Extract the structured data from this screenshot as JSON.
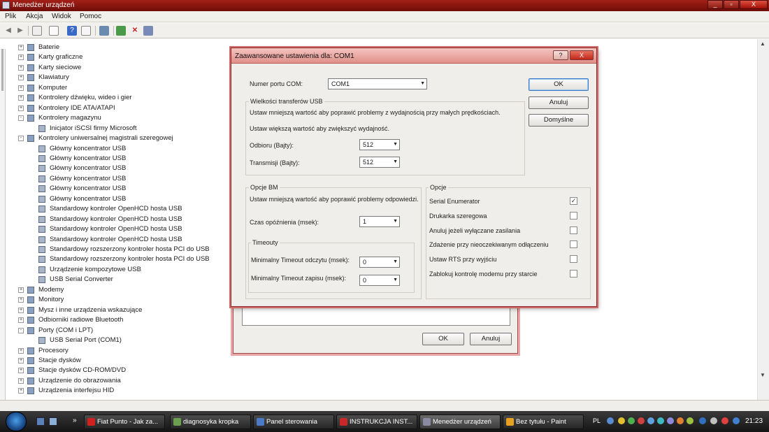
{
  "window": {
    "title": "Menedżer urządzeń",
    "controls": [
      "_",
      "▫",
      "X"
    ]
  },
  "menu": [
    "Plik",
    "Akcja",
    "Widok",
    "Pomoc"
  ],
  "tree": [
    {
      "label": "Baterie",
      "level": 1,
      "exp": "+",
      "icon": "battery-icon"
    },
    {
      "label": "Karty graficzne",
      "level": 1,
      "exp": "+",
      "icon": "display-adapter-icon"
    },
    {
      "label": "Karty sieciowe",
      "level": 1,
      "exp": "+",
      "icon": "network-adapter-icon"
    },
    {
      "label": "Klawiatury",
      "level": 1,
      "exp": "+",
      "icon": "keyboard-icon"
    },
    {
      "label": "Komputer",
      "level": 1,
      "exp": "+",
      "icon": "computer-icon"
    },
    {
      "label": "Kontrolery dźwięku, wideo i gier",
      "level": 1,
      "exp": "+",
      "icon": "sound-icon"
    },
    {
      "label": "Kontrolery IDE ATA/ATAPI",
      "level": 1,
      "exp": "+",
      "icon": "ide-icon"
    },
    {
      "label": "Kontrolery magazynu",
      "level": 1,
      "exp": "-",
      "icon": "storage-icon"
    },
    {
      "label": "Inicjator iSCSI firmy Microsoft",
      "level": 2,
      "exp": "",
      "icon": "iscsi-icon"
    },
    {
      "label": "Kontrolery uniwersalnej magistrali szeregowej",
      "level": 1,
      "exp": "-",
      "icon": "usb-icon"
    },
    {
      "label": "Główny koncentrator USB",
      "level": 2,
      "exp": "",
      "icon": "usb-device-icon"
    },
    {
      "label": "Główny koncentrator USB",
      "level": 2,
      "exp": "",
      "icon": "usb-device-icon"
    },
    {
      "label": "Główny koncentrator USB",
      "level": 2,
      "exp": "",
      "icon": "usb-device-icon"
    },
    {
      "label": "Główny koncentrator USB",
      "level": 2,
      "exp": "",
      "icon": "usb-device-icon"
    },
    {
      "label": "Główny koncentrator USB",
      "level": 2,
      "exp": "",
      "icon": "usb-device-icon"
    },
    {
      "label": "Główny koncentrator USB",
      "level": 2,
      "exp": "",
      "icon": "usb-device-icon"
    },
    {
      "label": "Standardowy kontroler OpenHCD hosta USB",
      "level": 2,
      "exp": "",
      "icon": "usb-device-icon"
    },
    {
      "label": "Standardowy kontroler OpenHCD hosta USB",
      "level": 2,
      "exp": "",
      "icon": "usb-device-icon"
    },
    {
      "label": "Standardowy kontroler OpenHCD hosta USB",
      "level": 2,
      "exp": "",
      "icon": "usb-device-icon"
    },
    {
      "label": "Standardowy kontroler OpenHCD hosta USB",
      "level": 2,
      "exp": "",
      "icon": "usb-device-icon"
    },
    {
      "label": "Standardowy rozszerzony kontroler hosta PCI do USB",
      "level": 2,
      "exp": "",
      "icon": "usb-device-icon"
    },
    {
      "label": "Standardowy rozszerzony kontroler hosta PCI do USB",
      "level": 2,
      "exp": "",
      "icon": "usb-device-icon"
    },
    {
      "label": "Urządzenie kompozytowe USB",
      "level": 2,
      "exp": "",
      "icon": "usb-device-icon"
    },
    {
      "label": "USB Serial Converter",
      "level": 2,
      "exp": "",
      "icon": "usb-device-icon"
    },
    {
      "label": "Modemy",
      "level": 1,
      "exp": "+",
      "icon": "modem-icon"
    },
    {
      "label": "Monitory",
      "level": 1,
      "exp": "+",
      "icon": "monitor-icon"
    },
    {
      "label": "Mysz i inne urządzenia wskazujące",
      "level": 1,
      "exp": "+",
      "icon": "mouse-icon"
    },
    {
      "label": "Odbiorniki radiowe Bluetooth",
      "level": 1,
      "exp": "+",
      "icon": "bluetooth-icon"
    },
    {
      "label": "Porty (COM i LPT)",
      "level": 1,
      "exp": "-",
      "icon": "port-icon"
    },
    {
      "label": "USB Serial Port (COM1)",
      "level": 2,
      "exp": "",
      "icon": "port-device-icon"
    },
    {
      "label": "Procesory",
      "level": 1,
      "exp": "+",
      "icon": "cpu-icon"
    },
    {
      "label": "Stacje dysków",
      "level": 1,
      "exp": "+",
      "icon": "disk-icon"
    },
    {
      "label": "Stacje dysków CD-ROM/DVD",
      "level": 1,
      "exp": "+",
      "icon": "cdrom-icon"
    },
    {
      "label": "Urządzenie do obrazowania",
      "level": 1,
      "exp": "+",
      "icon": "imaging-icon"
    },
    {
      "label": "Urządzenia interfejsu HID",
      "level": 1,
      "exp": "+",
      "icon": "hid-icon"
    }
  ],
  "bg_dialog": {
    "ok": "OK",
    "cancel": "Anuluj"
  },
  "adv": {
    "title": "Zaawansowane ustawienia dla: COM1",
    "help_btn": "?",
    "close_btn": "X",
    "com_port_label": "Numer portu COM:",
    "com_port_value": "COM1",
    "usb_group": "Wielkości transferów USB",
    "usb_hint1": "Ustaw mniejszą wartość aby poprawić problemy z wydajnością przy małych prędkościach.",
    "usb_hint2": "Ustaw większą wartość aby zwiększyć wydajność.",
    "receive_label": "Odbioru (Bajty):",
    "receive_value": "512",
    "transmit_label": "Transmisji (Bajty):",
    "transmit_value": "512",
    "bm_group": "Opcje BM",
    "bm_hint": "Ustaw mniejszą wartość aby poprawić problemy odpowiedzi.",
    "latency_label": "Czas opóźnienia (msek):",
    "latency_value": "1",
    "timeout_group": "Timeouty",
    "read_timeout_label": "Minimalny Timeout odczytu (msek):",
    "read_timeout_value": "0",
    "write_timeout_label": "Minimalny Timeout zapisu (msek):",
    "write_timeout_value": "0",
    "options_group": "Opcje",
    "options": [
      {
        "label": "Serial Enumerator",
        "checked": true
      },
      {
        "label": "Drukarka szeregowa",
        "checked": false
      },
      {
        "label": "Anuluj jeżeli wyłączane zasilania",
        "checked": false
      },
      {
        "label": "Zdażenie przy nieoczekiwanym odłączeniu",
        "checked": false
      },
      {
        "label": "Ustaw RTS przy wyjściu",
        "checked": false
      },
      {
        "label": "Zablokuj kontrolę modemu przy starcie",
        "checked": false
      }
    ],
    "ok": "OK",
    "cancel": "Anuluj",
    "defaults": "Domyślne"
  },
  "taskbar": {
    "tasks": [
      {
        "label": "Fiat Punto - Jak za...",
        "icon": "opera-icon",
        "color": "#d02020"
      },
      {
        "label": "diagnosyka kropka",
        "icon": "notepad-icon",
        "color": "#6aa050"
      },
      {
        "label": "Panel sterowania",
        "icon": "control-panel-icon",
        "color": "#4a7ac8"
      },
      {
        "label": "INSTRUKCJA INST...",
        "icon": "pdf-icon",
        "color": "#c82828"
      },
      {
        "label": "Menedżer urządzeń",
        "icon": "device-manager-icon",
        "color": "#8a8aa0"
      },
      {
        "label": "Bez tytułu - Paint",
        "icon": "paint-icon",
        "color": "#e8a020"
      }
    ],
    "lang": "PL",
    "clock": "21:23",
    "chevron": "»"
  }
}
